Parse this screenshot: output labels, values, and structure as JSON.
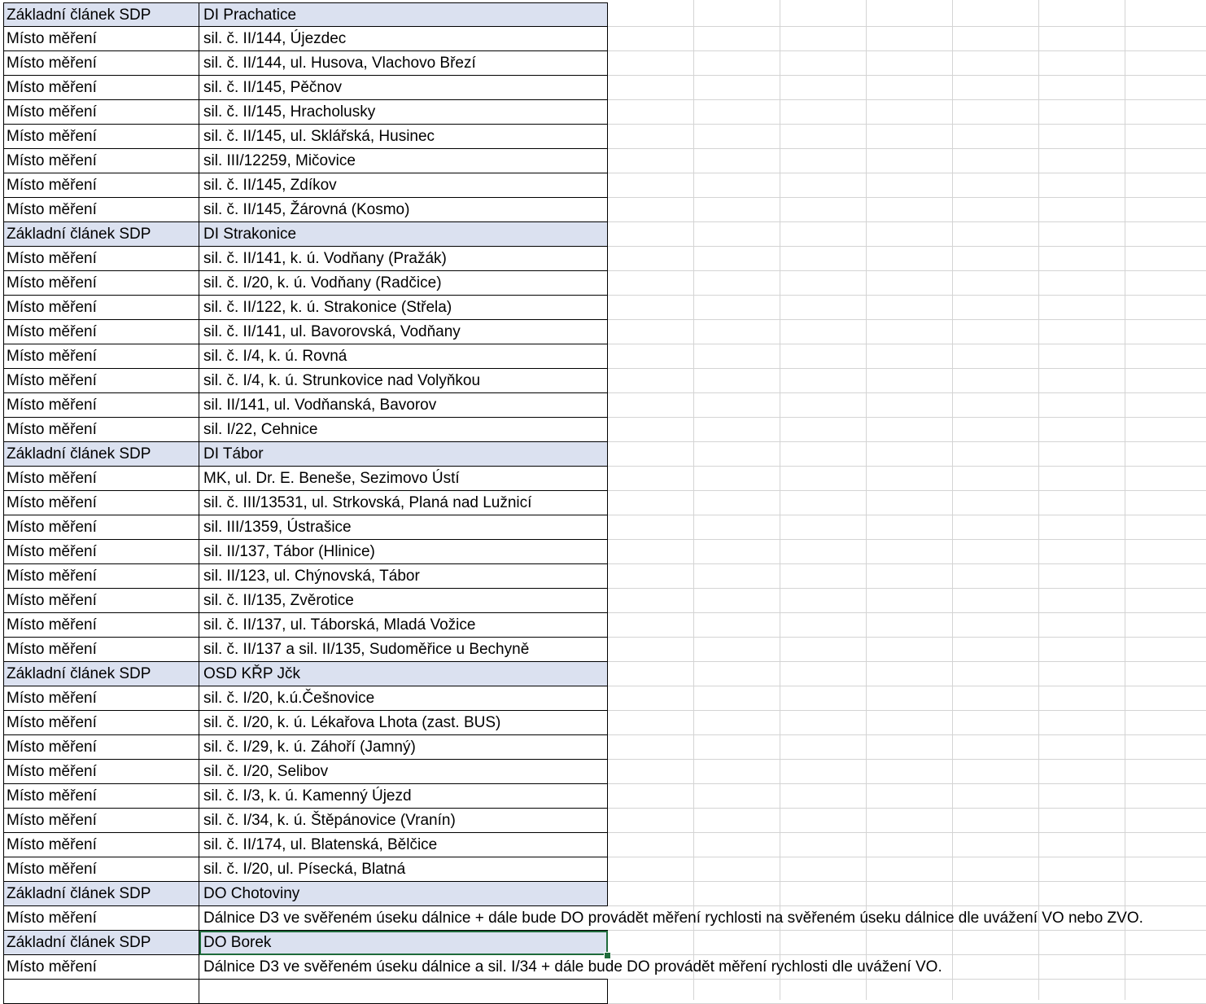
{
  "rows": [
    {
      "type": "header",
      "a": "Základní článek SDP",
      "b": "DI Prachatice"
    },
    {
      "type": "item",
      "a": "Místo měření",
      "b": "sil. č. II/144, Újezdec"
    },
    {
      "type": "item",
      "a": "Místo měření",
      "b": "sil. č. II/144, ul. Husova, Vlachovo Březí"
    },
    {
      "type": "item",
      "a": "Místo měření",
      "b": "sil. č. II/145, Pěčnov"
    },
    {
      "type": "item",
      "a": "Místo měření",
      "b": "sil. č. II/145, Hracholusky"
    },
    {
      "type": "item",
      "a": "Místo měření",
      "b": "sil. č. II/145, ul. Sklářská, Husinec"
    },
    {
      "type": "item",
      "a": "Místo měření",
      "b": "sil. III/12259, Mičovice"
    },
    {
      "type": "item",
      "a": "Místo měření",
      "b": "sil. č. II/145, Zdíkov"
    },
    {
      "type": "item",
      "a": "Místo měření",
      "b": "sil. č. II/145, Žárovná (Kosmo)"
    },
    {
      "type": "header",
      "a": "Základní článek SDP",
      "b": "DI Strakonice"
    },
    {
      "type": "item",
      "a": "Místo měření",
      "b": "sil. č. II/141, k. ú. Vodňany (Pražák)"
    },
    {
      "type": "item",
      "a": "Místo měření",
      "b": "sil. č. I/20, k. ú. Vodňany (Radčice)"
    },
    {
      "type": "item",
      "a": "Místo měření",
      "b": "sil. č. II/122, k. ú. Strakonice (Střela)"
    },
    {
      "type": "item",
      "a": "Místo měření",
      "b": "sil. č. II/141, ul. Bavorovská, Vodňany"
    },
    {
      "type": "item",
      "a": "Místo měření",
      "b": "sil. č. I/4, k. ú. Rovná"
    },
    {
      "type": "item",
      "a": "Místo měření",
      "b": "sil. č. I/4, k. ú. Strunkovice nad Volyňkou"
    },
    {
      "type": "item",
      "a": "Místo měření",
      "b": "sil. II/141, ul. Vodňanská, Bavorov"
    },
    {
      "type": "item",
      "a": "Místo měření",
      "b": "sil. I/22, Cehnice"
    },
    {
      "type": "header",
      "a": "Základní článek SDP",
      "b": "DI Tábor"
    },
    {
      "type": "item",
      "a": "Místo měření",
      "b": "MK, ul. Dr. E. Beneše, Sezimovo Ústí"
    },
    {
      "type": "item",
      "a": "Místo měření",
      "b": "sil. č. III/13531, ul. Strkovská, Planá nad Lužnicí"
    },
    {
      "type": "item",
      "a": "Místo měření",
      "b": "sil. III/1359, Ústrašice"
    },
    {
      "type": "item",
      "a": "Místo měření",
      "b": "sil. II/137, Tábor (Hlinice)"
    },
    {
      "type": "item",
      "a": "Místo měření",
      "b": "sil. II/123, ul. Chýnovská, Tábor"
    },
    {
      "type": "item",
      "a": "Místo měření",
      "b": "sil. č. II/135, Zvěrotice"
    },
    {
      "type": "item",
      "a": "Místo měření",
      "b": "sil. č. II/137, ul. Táborská, Mladá Vožice"
    },
    {
      "type": "item",
      "a": "Místo měření",
      "b": "sil. č. II/137 a sil. II/135, Sudoměřice u Bechyně"
    },
    {
      "type": "header",
      "a": "Základní článek SDP",
      "b": "OSD KŘP Jčk"
    },
    {
      "type": "item",
      "a": "Místo měření",
      "b": "sil. č. I/20, k.ú.Češnovice"
    },
    {
      "type": "item",
      "a": "Místo měření",
      "b": "sil. č. I/20, k. ú. Lékařova Lhota (zast. BUS)"
    },
    {
      "type": "item",
      "a": "Místo měření",
      "b": "sil. č. I/29, k. ú. Záhoří (Jamný)"
    },
    {
      "type": "item",
      "a": "Místo měření",
      "b": "sil. č. I/20, Selibov"
    },
    {
      "type": "item",
      "a": "Místo měření",
      "b": "sil. č. I/3, k. ú. Kamenný Újezd"
    },
    {
      "type": "item",
      "a": "Místo měření",
      "b": "sil. č. I/34, k. ú. Štěpánovice (Vranín)"
    },
    {
      "type": "item",
      "a": "Místo měření",
      "b": "sil. č. II/174, ul. Blatenská, Bělčice"
    },
    {
      "type": "item",
      "a": "Místo měření",
      "b": "sil. č. I/20, ul. Písecká, Blatná"
    },
    {
      "type": "header",
      "a": "Základní článek SDP",
      "b": "DO Chotoviny"
    },
    {
      "type": "overflow",
      "a": "Místo měření",
      "b": "Dálnice D3 ve svěřeném úseku dálnice + dále bude DO provádět měření rychlosti na svěřeném úseku dálnice dle uvážení VO nebo ZVO."
    },
    {
      "type": "header",
      "a": "Základní článek SDP",
      "b": "DO Borek",
      "selected": true
    },
    {
      "type": "overflow",
      "a": "Místo měření",
      "b": "Dálnice D3 ve svěřeném úseku dálnice a sil. I/34 + dále bude DO provádět měření rychlosti dle uvážení VO."
    },
    {
      "type": "empty",
      "a": "",
      "b": ""
    }
  ]
}
